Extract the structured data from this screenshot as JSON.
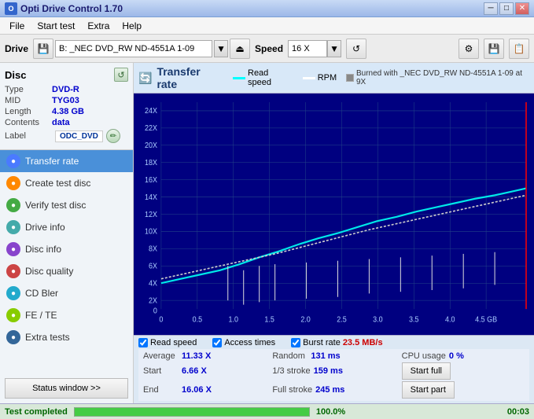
{
  "titlebar": {
    "title": "Opti Drive Control 1.70",
    "icon_label": "O",
    "minimize_label": "─",
    "maximize_label": "□",
    "close_label": "✕"
  },
  "menubar": {
    "items": [
      "File",
      "Start test",
      "Extra",
      "Help"
    ]
  },
  "drivebar": {
    "drive_label": "Drive",
    "drive_value": "B:  _NEC DVD_RW ND-4551A 1-09",
    "speed_label": "Speed",
    "speed_value": "16 X"
  },
  "disc": {
    "title": "Disc",
    "type_label": "Type",
    "type_value": "DVD-R",
    "mid_label": "MID",
    "mid_value": "TYG03",
    "length_label": "Length",
    "length_value": "4.38 GB",
    "contents_label": "Contents",
    "contents_value": "data",
    "label_label": "Label",
    "label_value": "ODC_DVD"
  },
  "nav": {
    "items": [
      {
        "id": "transfer-rate",
        "label": "Transfer rate",
        "icon": "●",
        "active": true
      },
      {
        "id": "create-test-disc",
        "label": "Create test disc",
        "icon": "●",
        "active": false
      },
      {
        "id": "verify-test-disc",
        "label": "Verify test disc",
        "icon": "●",
        "active": false
      },
      {
        "id": "drive-info",
        "label": "Drive info",
        "icon": "●",
        "active": false
      },
      {
        "id": "disc-info",
        "label": "Disc info",
        "icon": "●",
        "active": false
      },
      {
        "id": "disc-quality",
        "label": "Disc quality",
        "icon": "●",
        "active": false
      },
      {
        "id": "cd-bler",
        "label": "CD Bler",
        "icon": "●",
        "active": false
      },
      {
        "id": "fe-te",
        "label": "FE / TE",
        "icon": "●",
        "active": false
      },
      {
        "id": "extra-tests",
        "label": "Extra tests",
        "icon": "●",
        "active": false
      }
    ],
    "status_window_label": "Status window >>"
  },
  "chart": {
    "icon": "C",
    "title": "Transfer rate",
    "legend": [
      {
        "label": "Read speed",
        "color": "#00ffff"
      },
      {
        "label": "RPM",
        "color": "#ffffff"
      },
      {
        "label": "Burned with  _NEC DVD_RW ND-4551A 1-09 at 9X",
        "color": "#888888"
      }
    ],
    "y_labels": [
      "24X",
      "22X",
      "20X",
      "18X",
      "16X",
      "14X",
      "12X",
      "10X",
      "8X",
      "6X",
      "4X",
      "2X",
      "0"
    ],
    "x_labels": [
      "0",
      "0.5",
      "1.0",
      "1.5",
      "2.0",
      "2.5",
      "3.0",
      "3.5",
      "4.0",
      "4.5 GB"
    ]
  },
  "controls": {
    "read_speed_label": "Read speed",
    "access_times_label": "Access times",
    "burst_rate_label": "Burst rate",
    "burst_rate_value": "23.5 MB/s",
    "read_speed_checked": true,
    "access_times_checked": true,
    "burst_rate_checked": true
  },
  "stats": {
    "average_label": "Average",
    "average_value": "11.33 X",
    "random_label": "Random",
    "random_value": "131 ms",
    "cpu_label": "CPU usage",
    "cpu_value": "0 %",
    "start_label": "Start",
    "start_value": "6.66 X",
    "stroke13_label": "1/3 stroke",
    "stroke13_value": "159 ms",
    "startfull_label": "Start full",
    "end_label": "End",
    "end_value": "16.06 X",
    "full_stroke_label": "Full stroke",
    "full_stroke_value": "245 ms",
    "startpart_label": "Start part"
  },
  "statusbar": {
    "text": "Test completed",
    "progress": 100,
    "progress_label": "100.0%",
    "time": "00:03"
  }
}
